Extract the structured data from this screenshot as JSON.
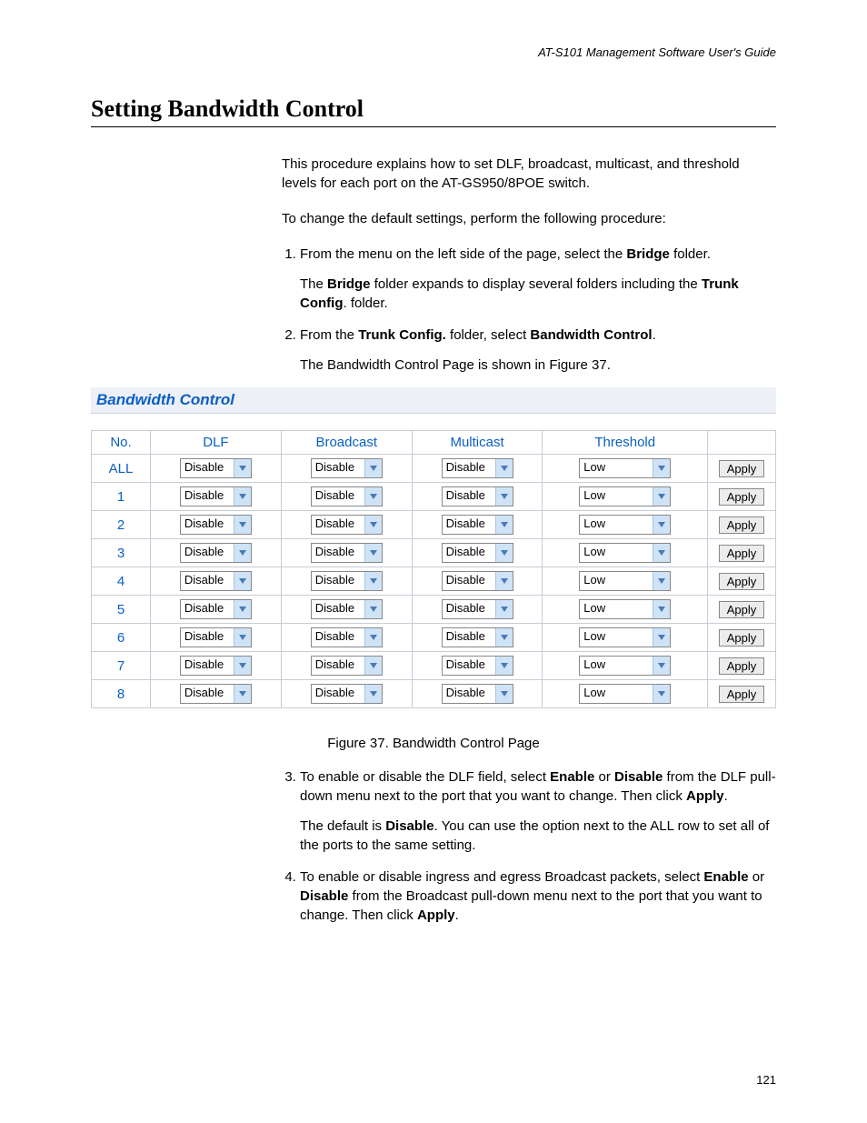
{
  "header": "AT-S101 Management Software User's Guide",
  "section_title": "Setting Bandwidth Control",
  "intro1": "This procedure explains how to set DLF, broadcast, multicast, and threshold levels for each port on the AT-GS950/8POE switch.",
  "intro2": "To change the default settings, perform the following procedure:",
  "step1_pre": "From the menu on the left side of the page, select the ",
  "step1_bold": "Bridge",
  "step1_post": " folder.",
  "step1_sub_pre": "The ",
  "step1_sub_b1": "Bridge",
  "step1_sub_mid": " folder expands to display several folders including the ",
  "step1_sub_b2": "Trunk Config",
  "step1_sub_post": ". folder.",
  "step2_pre": "From the ",
  "step2_b1": "Trunk Config.",
  "step2_mid": " folder, select ",
  "step2_b2": "Bandwidth Control",
  "step2_post": ".",
  "step2_sub": "The Bandwidth Control Page is shown in Figure 37.",
  "panel_title": "Bandwidth Control",
  "table": {
    "headers": {
      "no": "No.",
      "dlf": "DLF",
      "broadcast": "Broadcast",
      "multicast": "Multicast",
      "threshold": "Threshold"
    },
    "apply_label": "Apply",
    "rows": [
      {
        "no": "ALL",
        "dlf": "Disable",
        "broadcast": "Disable",
        "multicast": "Disable",
        "threshold": "Low"
      },
      {
        "no": "1",
        "dlf": "Disable",
        "broadcast": "Disable",
        "multicast": "Disable",
        "threshold": "Low"
      },
      {
        "no": "2",
        "dlf": "Disable",
        "broadcast": "Disable",
        "multicast": "Disable",
        "threshold": "Low"
      },
      {
        "no": "3",
        "dlf": "Disable",
        "broadcast": "Disable",
        "multicast": "Disable",
        "threshold": "Low"
      },
      {
        "no": "4",
        "dlf": "Disable",
        "broadcast": "Disable",
        "multicast": "Disable",
        "threshold": "Low"
      },
      {
        "no": "5",
        "dlf": "Disable",
        "broadcast": "Disable",
        "multicast": "Disable",
        "threshold": "Low"
      },
      {
        "no": "6",
        "dlf": "Disable",
        "broadcast": "Disable",
        "multicast": "Disable",
        "threshold": "Low"
      },
      {
        "no": "7",
        "dlf": "Disable",
        "broadcast": "Disable",
        "multicast": "Disable",
        "threshold": "Low"
      },
      {
        "no": "8",
        "dlf": "Disable",
        "broadcast": "Disable",
        "multicast": "Disable",
        "threshold": "Low"
      }
    ]
  },
  "figure_caption": "Figure 37. Bandwidth Control Page",
  "step3_pre": "To enable or disable the DLF field, select ",
  "step3_b1": "Enable",
  "step3_mid1": " or ",
  "step3_b2": "Disable",
  "step3_mid2": " from the DLF pull-down menu next to the port that you want to change. Then click ",
  "step3_b3": "Apply",
  "step3_post": ".",
  "step3_sub_pre": "The default is ",
  "step3_sub_b": "Disable",
  "step3_sub_post": ". You can use the option next to the ALL row to set all of the ports to the same setting.",
  "step4_pre": "To enable or disable ingress and egress Broadcast packets, select ",
  "step4_b1": "Enable",
  "step4_mid1": " or ",
  "step4_b2": "Disable",
  "step4_mid2": " from the Broadcast pull-down menu next to the port that you want to change. Then click ",
  "step4_b3": "Apply",
  "step4_post": ".",
  "page_number": "121"
}
